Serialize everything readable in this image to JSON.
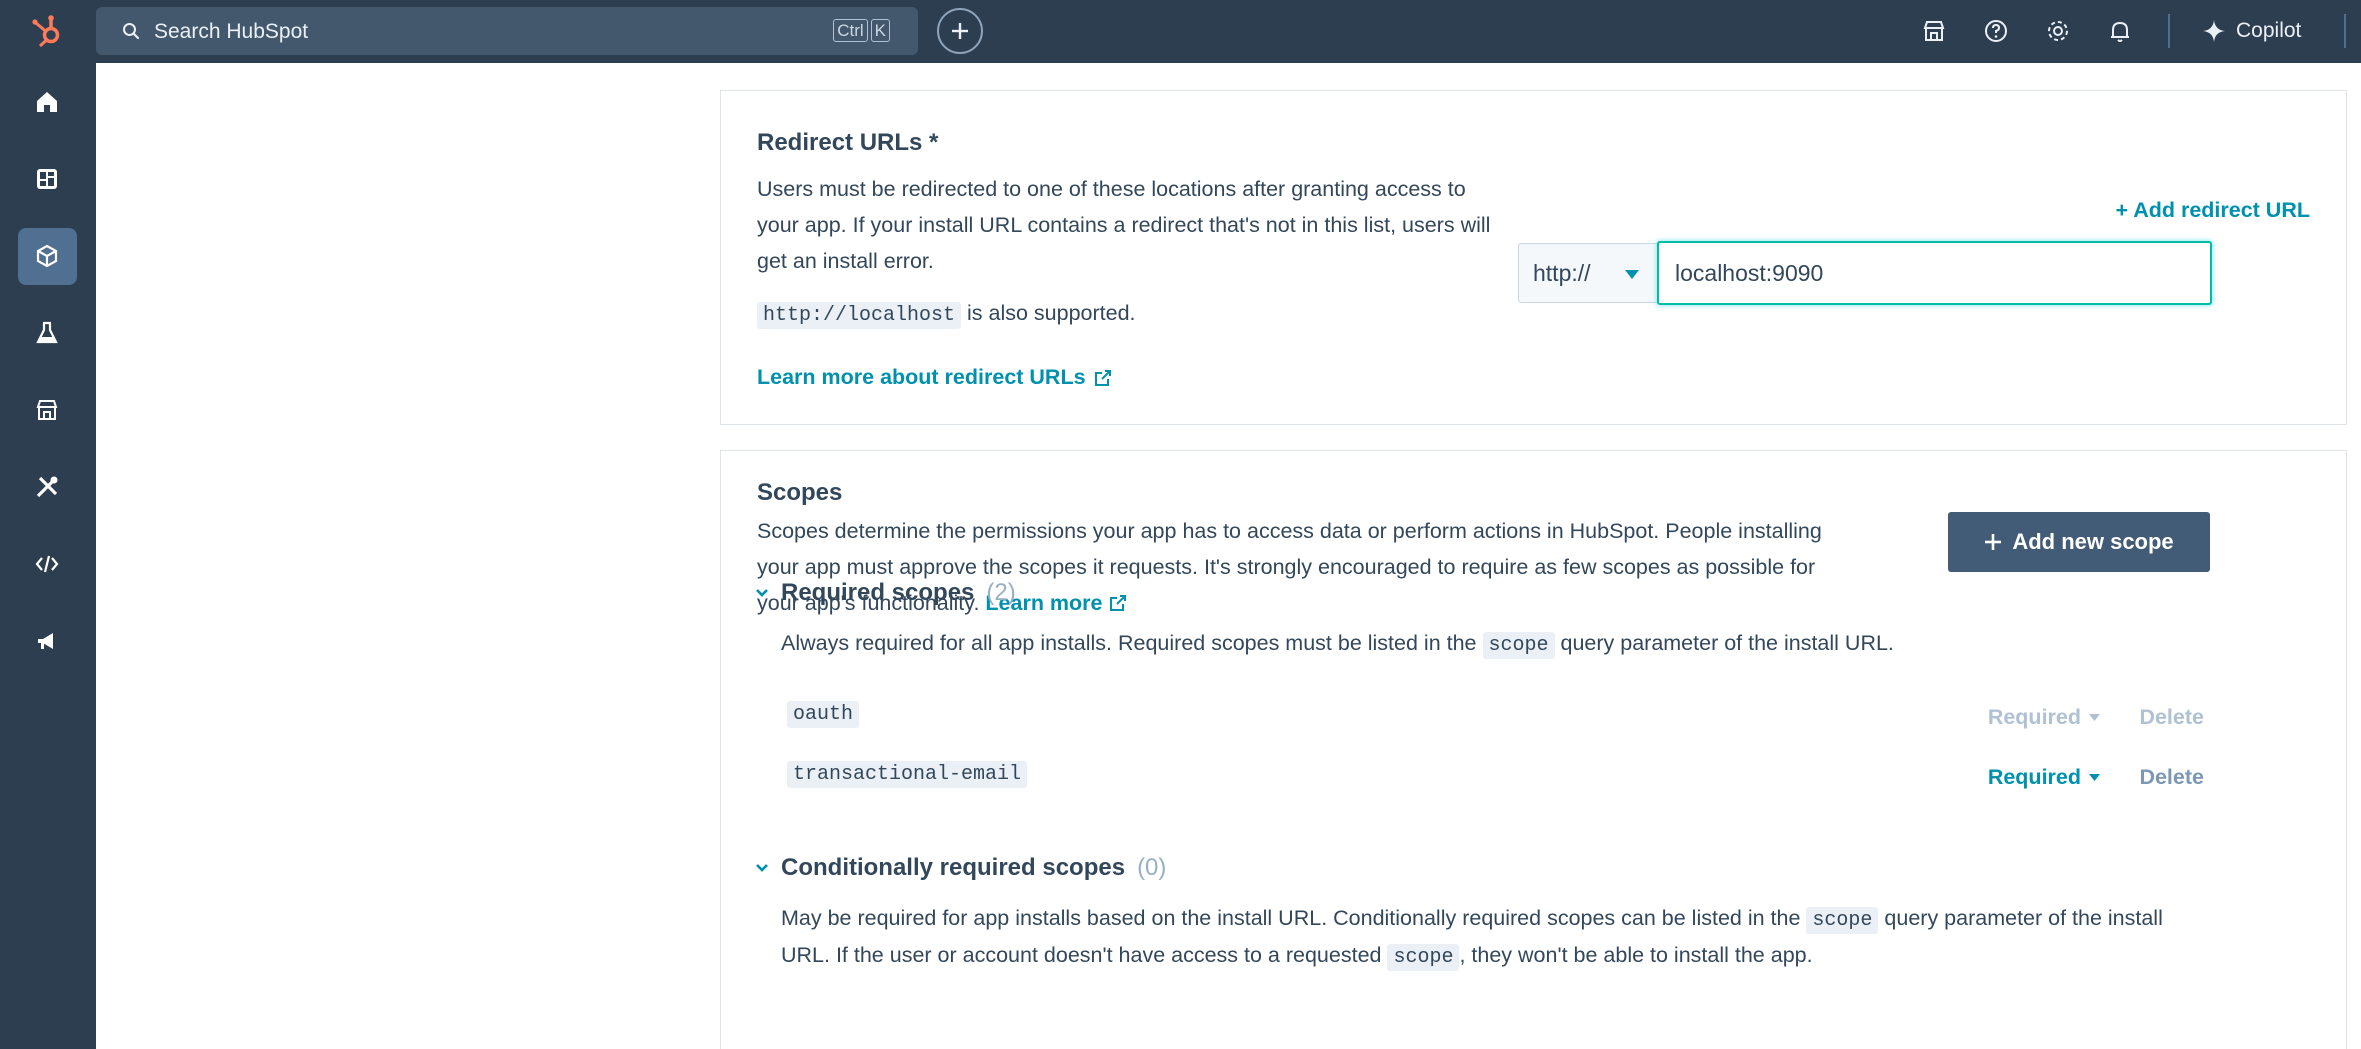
{
  "topbar": {
    "search_placeholder": "Search HubSpot",
    "shortcut_keys": [
      "Ctrl",
      "K"
    ],
    "copilot_label": "Copilot"
  },
  "colors": {
    "nav_bg": "#2d3e50",
    "accent_link": "#0091ae",
    "primary_button": "#425b76",
    "brand_orange": "#ff7a59",
    "focus_border": "#00bda5"
  },
  "sidebar": {
    "items": [
      {
        "icon": "home-icon"
      },
      {
        "icon": "dashboard-icon"
      },
      {
        "icon": "cube-icon",
        "active": true
      },
      {
        "icon": "flask-icon"
      },
      {
        "icon": "marketplace-icon"
      },
      {
        "icon": "tools-icon"
      },
      {
        "icon": "code-icon"
      },
      {
        "icon": "megaphone-icon"
      }
    ]
  },
  "redirect": {
    "title": "Redirect URLs *",
    "description": "Users must be redirected to one of these locations after granting access to your app. If your install URL contains a redirect that's not in this list, users will get an install error.",
    "localhost_code": "http://localhost",
    "localhost_suffix": " is also supported.",
    "learn_more": "Learn more about redirect URLs",
    "add_redirect": "+ Add redirect URL",
    "protocol": "http://",
    "url_value": "localhost:9090"
  },
  "scopes": {
    "title": "Scopes",
    "description": "Scopes determine the permissions your app has to access data or perform actions in HubSpot. People installing your app must approve the scopes it requests. It's strongly encouraged to require as few scopes as possible for your app's functionality.",
    "learn_more": "Learn more",
    "add_button": "Add new scope",
    "required": {
      "label": "Required scopes",
      "count": "(2)",
      "desc_before": "Always required for all app installs. Required scopes must be listed in the ",
      "desc_code": "scope",
      "desc_after": " query parameter of the install URL.",
      "items": [
        {
          "name": "oauth",
          "status": "Required",
          "delete": "Delete"
        },
        {
          "name": "transactional-email",
          "status": "Required",
          "delete": "Delete"
        }
      ]
    },
    "conditional": {
      "label": "Conditionally required scopes",
      "count": "(0)",
      "desc_part1": "May be required for app installs based on the install URL. Conditionally required scopes can be listed in the ",
      "desc_code1": "scope",
      "desc_part2": " query parameter of the install URL. If the user or account doesn't have access to a requested ",
      "desc_code2": "scope",
      "desc_part3": ", they won't be able to install the app."
    }
  }
}
